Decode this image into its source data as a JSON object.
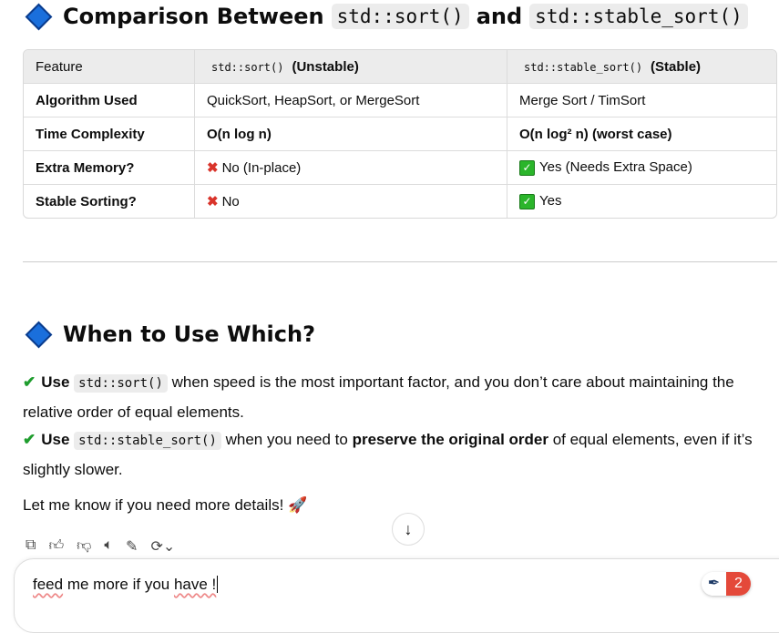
{
  "heading1": {
    "pre": "Comparison Between",
    "code1": "std::sort()",
    "mid": "and",
    "code2": "std::stable_sort()"
  },
  "table": {
    "headers": [
      {
        "text": "Feature"
      },
      {
        "code": "std::sort()",
        "text": "(Unstable)"
      },
      {
        "code": "std::stable_sort()",
        "text": "(Stable)"
      }
    ],
    "rows": [
      [
        "Algorithm Used",
        "QuickSort, HeapSort, or MergeSort",
        "Merge Sort / TimSort"
      ],
      [
        "Time Complexity",
        "O(n log n)",
        "O(n log² n) (worst case)"
      ],
      [
        "Extra Memory?",
        "No (In-place)",
        "Yes (Needs Extra Space)"
      ],
      [
        "Stable Sorting?",
        "No",
        "Yes"
      ]
    ]
  },
  "heading2": "When to Use Which?",
  "bullets": [
    {
      "use": "Use",
      "code": "std::sort()",
      "text": " when speed is the most important factor, and you don’t care about maintaining the relative order of equal elements."
    },
    {
      "use": "Use",
      "code": "std::stable_sort()",
      "text": " when you need to ",
      "bold": "preserve the original order",
      "text2": " of equal elements, even if it’s slightly slower."
    }
  ],
  "closing": "Let me know if you need more details! 🚀",
  "actions": [
    "copy-icon",
    "thumbs-up-icon",
    "thumbs-down-icon",
    "read-aloud-icon",
    "edit-icon",
    "regenerate-icon"
  ],
  "input": {
    "w1": "feed",
    "w2": " me more if you ",
    "w3": "have !",
    "badge_count": "2"
  }
}
